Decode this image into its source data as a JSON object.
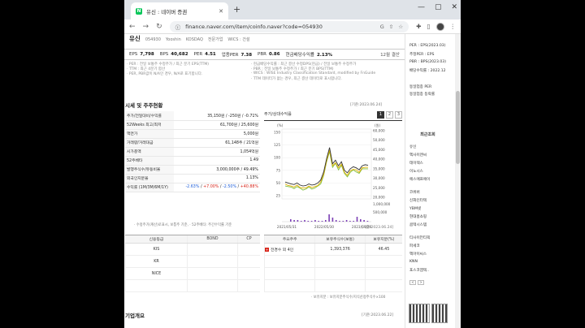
{
  "browser": {
    "tab_title": "유신 : 네이버 증권",
    "tab_favicon": "N",
    "url": "finance.naver.com/item/coinfo.naver?code=054930",
    "new_tab": "+",
    "controls": {
      "minimize": "—",
      "restore": "▢",
      "close": "✕"
    }
  },
  "company": {
    "name": "유신",
    "code": "054930",
    "en_name": "Yooshin",
    "market": "KOSDAQ",
    "sector": "전문가업",
    "wics": "WICS : 건설"
  },
  "metrics": [
    {
      "label": "EPS",
      "value": "7,798"
    },
    {
      "label": "BPS",
      "value": "40,682"
    },
    {
      "label": "PER",
      "value": "4.51"
    },
    {
      "label": "업종PER",
      "value": "7.38"
    },
    {
      "label": "PBR",
      "value": "0.86"
    },
    {
      "label": "현금배당수익률",
      "value": "2.13%"
    }
  ],
  "metrics_period": "12월 결산",
  "notes": [
    [
      "· PER : 전일 보통주 수정주가 / 최근 분기 EPS(TTM)",
      "· 현금배당수익률 : 최근 결산 수정DPS(현금) / 전일 보통주 수정주가"
    ],
    [
      "· TTM : 최근 4분기 합산",
      "· PBR : 전일 보통주 수정주가 / 최근 분기 BPS(TTM)"
    ],
    [
      "· PER, PBR값이 N/A인 경우, N/A로 표기합니다.",
      "· WICS : WISE Industry Classification Standard, modified by FnGuide"
    ],
    [
      "",
      "· TTM 데이터가 없는 경우, 최근 결산 데이터로 표시합니다."
    ]
  ],
  "section_market": {
    "title": "시세 및 주주현황",
    "date": "[기준:2023.06.24]"
  },
  "market_rows": [
    {
      "label": "주가/전일대비/수익률",
      "value": "35,150원 / -250원 / -0.71%",
      "type": "price"
    },
    {
      "label": "52Weeks 최고/최저",
      "value": "61,700원 / 25,600원"
    },
    {
      "label": "액면가",
      "value": "5,000원"
    },
    {
      "label": "거래량/거래대금",
      "value": "61,148주 / 21억원"
    },
    {
      "label": "시가총액",
      "value": "1,054억원"
    },
    {
      "label": "52주베타",
      "value": "1.49"
    },
    {
      "label": "발행주식수/유동비율",
      "value": "3,000,000주 / 49.49%"
    },
    {
      "label": "외국인지분율",
      "value": "1.13%"
    },
    {
      "label": "수익률 (1M/3M/6M/1Y)",
      "value_parts": [
        "-2.63%",
        "+7.00%",
        "-2.50%",
        "+40.88%"
      ]
    }
  ],
  "market_remark": "· 수정주가(계산)로표시, 보통주 기준, · 52주베타: 주간수익률 기준",
  "chart": {
    "title": "주가/상대수익률",
    "tabs": [
      "1",
      "2",
      "3"
    ],
    "left_unit": "(%)",
    "right_unit": "(원)",
    "y_left_ticks": [
      150,
      125,
      100,
      75,
      50,
      25
    ],
    "y_right_ticks": [
      "60,000",
      "50,000",
      "45,000",
      "40,000",
      "35,000",
      "30,000",
      "25,000",
      "20,000"
    ],
    "vol_ticks": [
      "1,000,000",
      "500,000"
    ],
    "x_ticks": [
      "2021/05/31",
      "2022/05/30",
      "2023/04/28"
    ],
    "legend": [
      {
        "name": "유신",
        "color": "#333333",
        "kind": "line"
      },
      {
        "name": "KOSDAQ대비(좌)",
        "color": "#e0b000",
        "kind": "line"
      },
      {
        "name": "전문기술대비(좌)",
        "color": "#7fbf3f",
        "kind": "line"
      },
      {
        "name": "거래량",
        "color": "#7b3fb5",
        "kind": "bar"
      }
    ]
  },
  "chart_date": "[기준:2023.06.24]",
  "credit": {
    "headers": [
      "신용등급",
      "BOND",
      "CP"
    ],
    "rows": [
      "KIS",
      "KR",
      "NICE"
    ]
  },
  "holders": {
    "headers": [
      "주요주주",
      "보유주식수(보통)",
      "보유지분(%)"
    ],
    "rows": [
      {
        "name": "전경수 외 4인",
        "shares": "1,393,376",
        "pct": "46.45"
      }
    ]
  },
  "holders_remark": "· 보유지분 : 보유지분주식수/지식산정주식수×100",
  "section_overview": {
    "title": "기업개요",
    "date": "[기준:2023.06.22]"
  },
  "side": {
    "top_items": [
      "PER : EPS(2023.03)",
      "추정PER : EPS",
      "PBR : BPS(2023.03)",
      "배당수익률 : 2022.12"
    ],
    "mid_items": [
      "동일업종 PER",
      "동일업종 등락률"
    ],
    "recent_header": "최근조회",
    "recent": [
      "유신",
      "엑사이엔씨",
      "테이텍스",
      "이노시스",
      "에스에프에이"
    ],
    "recent2": [
      "코위버",
      "신화인터텍",
      "YBM넷",
      "현대홈쇼핑",
      "콤텍시스템"
    ],
    "recent3": [
      "티사이언티픽",
      "파세코",
      "엑아이씨스",
      "KNN",
      "포스코엠텍.."
    ],
    "pager": [
      "<",
      ">"
    ]
  }
}
